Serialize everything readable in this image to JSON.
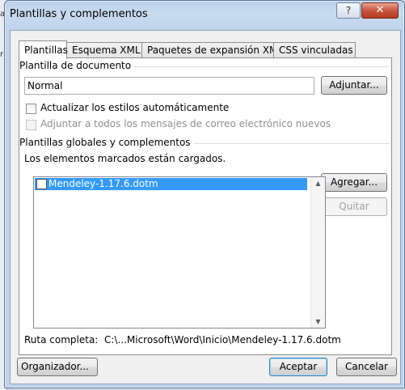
{
  "background": {
    "char_a": "a",
    "char_b": "r"
  },
  "window": {
    "title": "Plantillas y complementos",
    "help_label": "?",
    "close_label": "✕"
  },
  "tabs": [
    {
      "label": "Plantillas",
      "active": true
    },
    {
      "label": "Esquema XML",
      "active": false
    },
    {
      "label": "Paquetes de expansión XML",
      "active": false
    },
    {
      "label": "CSS vinculadas",
      "active": false
    }
  ],
  "document_template": {
    "group_label": "Plantilla de documento",
    "value": "Normal",
    "attach_button": "Adjuntar...",
    "auto_update_label": "Actualizar los estilos automáticamente",
    "auto_update_checked": false,
    "attach_all_label": "Adjuntar a todos los mensajes de correo electrónico nuevos",
    "attach_all_checked": false,
    "attach_all_enabled": false
  },
  "global_templates": {
    "group_label": "Plantillas globales y complementos",
    "loaded_note": "Los elementos marcados están cargados.",
    "items": [
      {
        "label": "Mendeley-1.17.6.dotm",
        "checked": false,
        "selected": true
      }
    ],
    "add_button": "Agregar...",
    "remove_button": "Quitar",
    "remove_enabled": false,
    "path_label": "Ruta completa:",
    "path_value": "C:\\...Microsoft\\Word\\Inicio\\Mendeley-1.17.6.dotm"
  },
  "footer": {
    "organizer_button": "Organizador...",
    "ok_button": "Aceptar",
    "cancel_button": "Cancelar"
  },
  "colors": {
    "title_bar": "#bfd3ea",
    "close_button": "#c8553e",
    "selection": "#3399ff"
  }
}
